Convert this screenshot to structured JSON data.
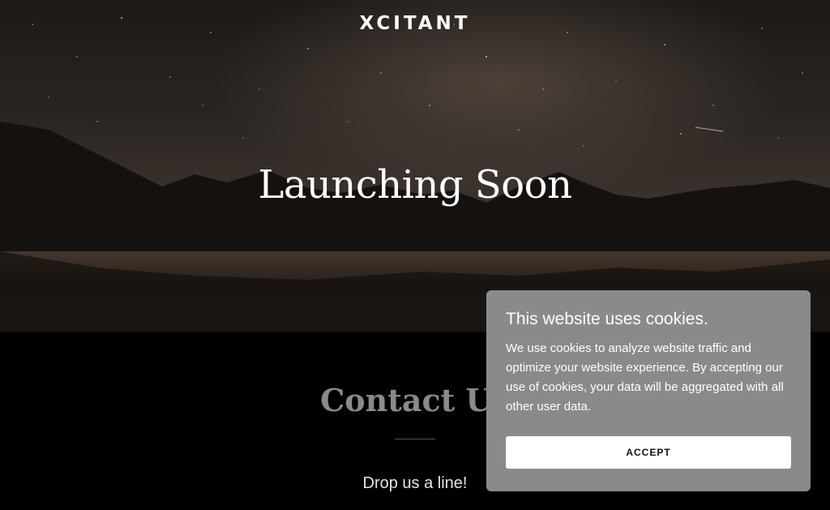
{
  "header": {
    "brand": "XCITANT"
  },
  "hero": {
    "headline": "Launching Soon"
  },
  "contact": {
    "title": "Contact Us",
    "subtitle": "Drop us a line!"
  },
  "cookie_banner": {
    "title": "This website uses cookies.",
    "body": "We use cookies to analyze website traffic and optimize your website experience. By accepting our use of cookies, your data will be aggregated with all other user data.",
    "accept_label": "ACCEPT"
  },
  "colors": {
    "background": "#000000",
    "banner": "#8a8a8a",
    "accept_button": "#ffffff"
  }
}
